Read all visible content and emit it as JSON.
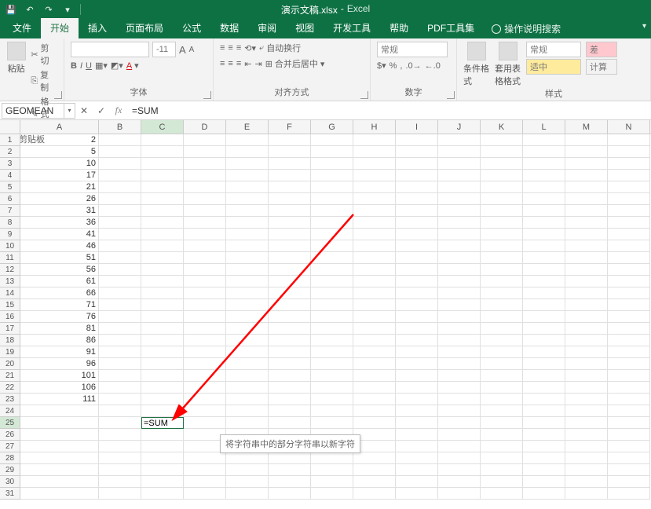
{
  "title": {
    "filename": "演示文稿.xlsx",
    "sep": "-",
    "appname": "Excel"
  },
  "qat": {
    "save": "💾",
    "undo": "↶",
    "redo": "↷"
  },
  "tabs": {
    "file": "文件",
    "home": "开始",
    "insert": "插入",
    "layout": "页面布局",
    "formulas": "公式",
    "data": "数据",
    "review": "审阅",
    "view": "视图",
    "dev": "开发工具",
    "help": "帮助",
    "pdf": "PDF工具集",
    "tellme": "操作说明搜索"
  },
  "ribbon": {
    "clipboard": {
      "paste": "粘贴",
      "cut": "剪切",
      "copy": "复制",
      "painter": "格式刷",
      "label": "剪贴板"
    },
    "font": {
      "label": "字体",
      "bold": "B",
      "italic": "I",
      "underline": "U",
      "size_up": "A",
      "size_dn": "A"
    },
    "align": {
      "label": "对齐方式",
      "wrap": "自动换行",
      "merge": "合并后居中"
    },
    "number": {
      "label": "数字",
      "format": "常规"
    },
    "styles": {
      "label": "样式",
      "cond": "条件格式",
      "table": "套用表格格式",
      "normal": "常规",
      "neutral": "适中",
      "calc": "计算"
    }
  },
  "formula_bar": {
    "namebox": "GEOMEAN",
    "cancel": "✕",
    "enter": "✓",
    "fx": "fx",
    "formula": "=SUM"
  },
  "grid": {
    "columns": [
      "A",
      "B",
      "C",
      "D",
      "E",
      "F",
      "G",
      "H",
      "I",
      "J",
      "K",
      "L",
      "M",
      "N"
    ],
    "data_colA": [
      "2",
      "5",
      "10",
      "17",
      "21",
      "26",
      "31",
      "36",
      "41",
      "46",
      "51",
      "56",
      "61",
      "66",
      "71",
      "76",
      "81",
      "86",
      "91",
      "96",
      "101",
      "106",
      "111"
    ],
    "active_cell_value": "=SUM",
    "tooltip": "将字符串中的部分字符串以新字符"
  }
}
